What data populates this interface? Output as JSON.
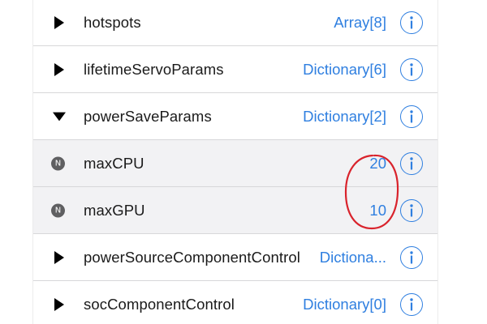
{
  "colors": {
    "accent": "#2f7fe0",
    "annotation": "#d9232c"
  },
  "rows": [
    {
      "key": "hotspots",
      "value": "Array[8]",
      "expander": "collapsed"
    },
    {
      "key": "lifetimeServoParams",
      "value": "Dictionary[6]",
      "expander": "collapsed"
    },
    {
      "key": "powerSaveParams",
      "value": "Dictionary[2]",
      "expander": "expanded"
    },
    {
      "key": "maxCPU",
      "value": "20",
      "badge": "N"
    },
    {
      "key": "maxGPU",
      "value": "10",
      "badge": "N"
    },
    {
      "key": "powerSourceComponentControl",
      "value": "Dictiona...",
      "expander": "collapsed"
    },
    {
      "key": "socComponentControl",
      "value": "Dictionary[0]",
      "expander": "collapsed"
    }
  ]
}
